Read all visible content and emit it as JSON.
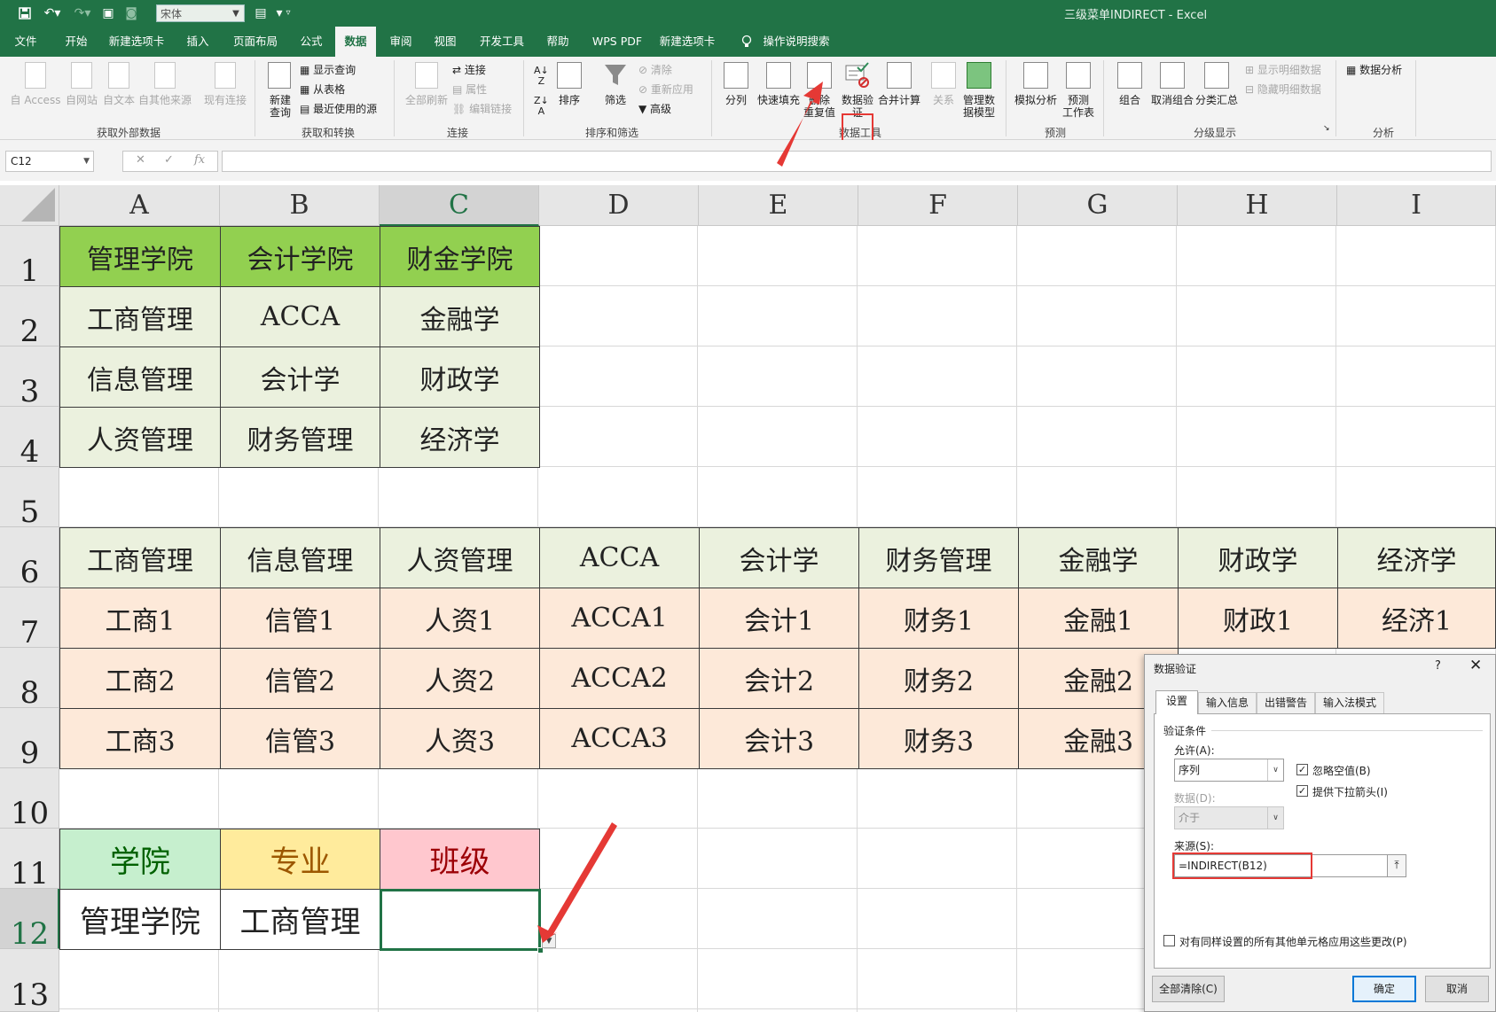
{
  "titlebar": {
    "font_name": "宋体",
    "title": "三级菜单INDIRECT - Excel"
  },
  "tabs": [
    {
      "label": "文件"
    },
    {
      "label": "开始"
    },
    {
      "label": "新建选项卡"
    },
    {
      "label": "插入"
    },
    {
      "label": "页面布局"
    },
    {
      "label": "公式"
    },
    {
      "label": "数据"
    },
    {
      "label": "审阅"
    },
    {
      "label": "视图"
    },
    {
      "label": "开发工具"
    },
    {
      "label": "帮助"
    },
    {
      "label": "WPS PDF"
    },
    {
      "label": "新建选项卡"
    },
    {
      "label": "操作说明搜索"
    }
  ],
  "ribbon": {
    "ext": {
      "access": "自 Access",
      "web": "自网站",
      "text": "自文本",
      "other": "自其他来源",
      "existing": "现有连接",
      "group": "获取外部数据"
    },
    "transform": {
      "new_query": "新建",
      "new_query2": "查询",
      "show_queries": "显示查询",
      "from_table": "从表格",
      "recent": "最近使用的源",
      "group": "获取和转换"
    },
    "connections": {
      "refresh_all": "全部刷新",
      "connections": "连接",
      "properties": "属性",
      "edit_links": "编辑链接",
      "group": "连接"
    },
    "sort": {
      "sort": "排序",
      "filter": "筛选",
      "clear": "清除",
      "reapply": "重新应用",
      "advanced": "高级",
      "group": "排序和筛选"
    },
    "tools": {
      "split": "分列",
      "flash_fill": "快速填充",
      "remove_dup": "删除",
      "remove_dup2": "重复值",
      "validation": "数据验",
      "validation2": "证",
      "consolidate": "合并计算",
      "relations": "关系",
      "data_model": "管理数",
      "data_model2": "据模型",
      "group": "数据工具"
    },
    "forecast": {
      "whatif": "模拟分析",
      "forecast": "预测",
      "forecast2": "工作表",
      "group": "预测"
    },
    "outline": {
      "group_btn": "组合",
      "ungroup": "取消组合",
      "subtotal": "分类汇总",
      "show_detail": "显示明细数据",
      "hide_detail": "隐藏明细数据",
      "group": "分级显示"
    },
    "analysis": {
      "data_analysis": "数据分析",
      "group": "分析"
    }
  },
  "formula_bar": {
    "name_box": "C12",
    "fx": "fx",
    "formula": ""
  },
  "columns": [
    "A",
    "B",
    "C",
    "D",
    "E",
    "F",
    "G",
    "H",
    "I"
  ],
  "rows": [
    "1",
    "2",
    "3",
    "4",
    "5",
    "6",
    "7",
    "8",
    "9",
    "10",
    "11",
    "12",
    "13"
  ],
  "cells": {
    "A1": "管理学院",
    "B1": "会计学院",
    "C1": "财金学院",
    "A2": "工商管理",
    "B2": "ACCA",
    "C2": "金融学",
    "A3": "信息管理",
    "B3": "会计学",
    "C3": "财政学",
    "A4": "人资管理",
    "B4": "财务管理",
    "C4": "经济学",
    "A6": "工商管理",
    "B6": "信息管理",
    "C6": "人资管理",
    "D6": "ACCA",
    "E6": "会计学",
    "F6": "财务管理",
    "G6": "金融学",
    "H6": "财政学",
    "I6": "经济学",
    "A7": "工商1",
    "B7": "信管1",
    "C7": "人资1",
    "D7": "ACCA1",
    "E7": "会计1",
    "F7": "财务1",
    "G7": "金融1",
    "H7": "财政1",
    "I7": "经济1",
    "A8": "工商2",
    "B8": "信管2",
    "C8": "人资2",
    "D8": "ACCA2",
    "E8": "会计2",
    "F8": "财务2",
    "G8": "金融2",
    "A9": "工商3",
    "B9": "信管3",
    "C9": "人资3",
    "D9": "ACCA3",
    "E9": "会计3",
    "F9": "财务3",
    "G9": "金融3",
    "A11": "学院",
    "B11": "专业",
    "C11": "班级",
    "A12": "管理学院",
    "B12": "工商管理",
    "C12": ""
  },
  "colors": {
    "excel_green": "#217346",
    "header_green": "#92d050",
    "light_green": "#ebf1de",
    "peach": "#fde9d9",
    "label_college_bg": "#c6efce",
    "label_college_fg": "#006100",
    "label_major_bg": "#ffeb9c",
    "label_major_fg": "#9c5700",
    "label_class_bg": "#ffc7ce",
    "label_class_fg": "#9c0006",
    "annotation_red": "#e53935"
  },
  "dialog": {
    "title": "数据验证",
    "help": "?",
    "close": "✕",
    "tabs": [
      "设置",
      "输入信息",
      "出错警告",
      "输入法模式"
    ],
    "section": "验证条件",
    "allow_label": "允许(A):",
    "allow_value": "序列",
    "ignore_blank": "忽略空值(B)",
    "dropdown": "提供下拉箭头(I)",
    "data_label": "数据(D):",
    "data_value": "介于",
    "source_label": "来源(S):",
    "source_value": "=INDIRECT(B12)",
    "apply_all": "对有同样设置的所有其他单元格应用这些更改(P)",
    "clear_all": "全部清除(C)",
    "ok": "确定",
    "cancel": "取消"
  }
}
